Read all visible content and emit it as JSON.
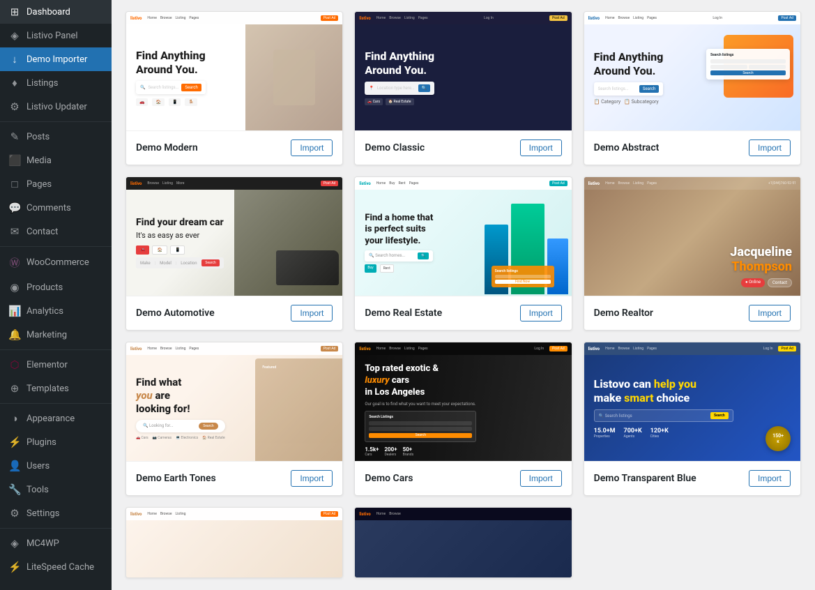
{
  "sidebar": {
    "items": [
      {
        "id": "dashboard",
        "label": "Dashboard",
        "icon": "⊞",
        "active": false
      },
      {
        "id": "listivo-panel",
        "label": "Listivo Panel",
        "icon": "◈",
        "active": false
      },
      {
        "id": "demo-importer",
        "label": "Demo Importer",
        "icon": "↓",
        "active": true
      },
      {
        "id": "listings",
        "label": "Listings",
        "icon": "♦",
        "active": false
      },
      {
        "id": "listivo-updater",
        "label": "Listivo Updater",
        "icon": "⚙",
        "active": false
      },
      {
        "id": "posts",
        "label": "Posts",
        "icon": "✎",
        "active": false
      },
      {
        "id": "media",
        "label": "Media",
        "icon": "⬛",
        "active": false
      },
      {
        "id": "pages",
        "label": "Pages",
        "icon": "□",
        "active": false
      },
      {
        "id": "comments",
        "label": "Comments",
        "icon": "💬",
        "active": false
      },
      {
        "id": "contact",
        "label": "Contact",
        "icon": "✉",
        "active": false
      },
      {
        "id": "woocommerce",
        "label": "WooCommerce",
        "icon": "Ⓦ",
        "active": false
      },
      {
        "id": "products",
        "label": "Products",
        "icon": "◉",
        "active": false
      },
      {
        "id": "analytics",
        "label": "Analytics",
        "icon": "📊",
        "active": false
      },
      {
        "id": "marketing",
        "label": "Marketing",
        "icon": "🔔",
        "active": false
      },
      {
        "id": "elementor",
        "label": "Elementor",
        "icon": "⬡",
        "active": false
      },
      {
        "id": "templates",
        "label": "Templates",
        "icon": "⊕",
        "active": false
      },
      {
        "id": "appearance",
        "label": "Appearance",
        "icon": "◑",
        "active": false
      },
      {
        "id": "plugins",
        "label": "Plugins",
        "icon": "⚡",
        "active": false
      },
      {
        "id": "users",
        "label": "Users",
        "icon": "👤",
        "active": false
      },
      {
        "id": "tools",
        "label": "Tools",
        "icon": "🔧",
        "active": false
      },
      {
        "id": "settings",
        "label": "Settings",
        "icon": "⚙",
        "active": false
      },
      {
        "id": "mc4wp",
        "label": "MC4WP",
        "icon": "◈",
        "active": false
      },
      {
        "id": "litespeed",
        "label": "LiteSpeed Cache",
        "icon": "⚡",
        "active": false
      }
    ]
  },
  "demos": [
    {
      "id": "modern",
      "title": "Demo Modern",
      "import_label": "Import",
      "theme": "modern",
      "hero_title": "Find Anything\nAround You.",
      "hero_color": "#1d1d1d"
    },
    {
      "id": "classic",
      "title": "Demo Classic",
      "import_label": "Import",
      "theme": "classic",
      "hero_title": "Find Anything\nAround You.",
      "hero_color": "#fff"
    },
    {
      "id": "abstract",
      "title": "Demo Abstract",
      "import_label": "Import",
      "theme": "abstract",
      "hero_title": "Find Anything\nAround You.",
      "hero_color": "#1d1d1d"
    },
    {
      "id": "automotive",
      "title": "Demo Automotive",
      "import_label": "Import",
      "theme": "auto",
      "hero_title": "Find your dream car\nIt's as easy as ever",
      "hero_color": "#1d1d1d"
    },
    {
      "id": "realestate",
      "title": "Demo Real Estate",
      "import_label": "Import",
      "theme": "realestate",
      "hero_title": "Find a home that\nis perfect suits\nyour lifestyle.",
      "hero_color": "#1d1d1d"
    },
    {
      "id": "realtor",
      "title": "Demo Realtor",
      "import_label": "Import",
      "theme": "realtor",
      "person_name": "Jacqueline\nThompson",
      "hero_color": "#fff"
    },
    {
      "id": "earthtones",
      "title": "Demo Earth Tones",
      "import_label": "Import",
      "theme": "earth",
      "hero_title": "Find what\nyou are\nlooking for!",
      "hero_color": "#1d1d1d"
    },
    {
      "id": "cars",
      "title": "Demo Cars",
      "import_label": "Import",
      "theme": "cars",
      "hero_title": "Top rated exotic &\nluxury cars\nin Los Angeles",
      "hero_color": "#fff"
    },
    {
      "id": "transparentblue",
      "title": "Demo Transparent Blue",
      "import_label": "Import",
      "theme": "blue",
      "hero_title": "Listovo can help you\nmake smart choice",
      "stats": [
        {
          "value": "15.0+M",
          "label": "Properties"
        },
        {
          "value": "700+K",
          "label": "Agents"
        },
        {
          "value": "120+K",
          "label": "Cities"
        }
      ]
    }
  ]
}
